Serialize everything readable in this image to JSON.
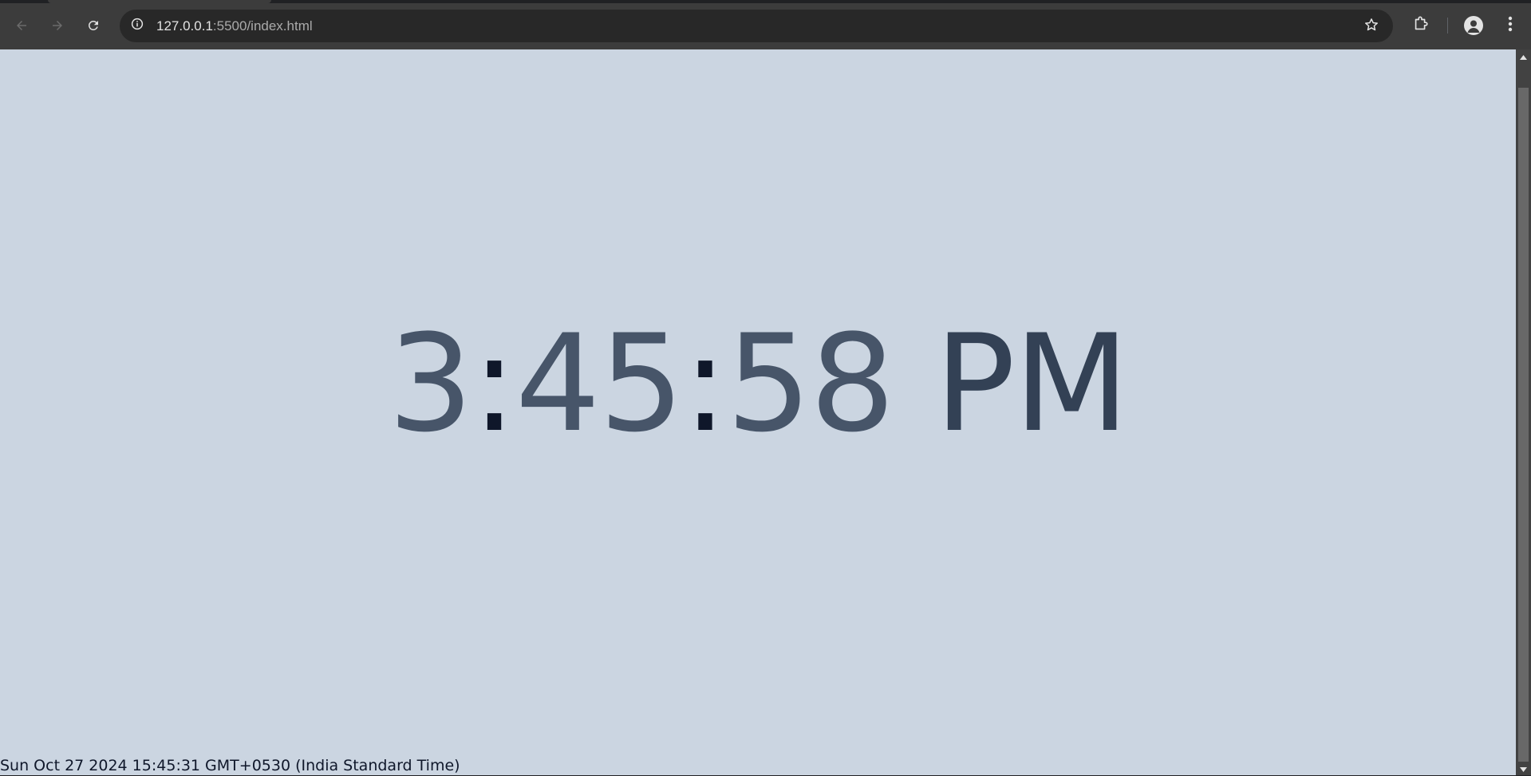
{
  "browser": {
    "url_host": "127.0.0.1",
    "url_path": ":5500/index.html",
    "icons": {
      "back": "arrow-left-icon",
      "forward": "arrow-right-icon",
      "reload": "reload-icon",
      "site_info": "info-icon",
      "bookmark": "star-icon",
      "extensions": "puzzle-icon",
      "profile": "person-icon",
      "menu": "kebab-menu-icon"
    }
  },
  "page": {
    "background": "#cbd5e1",
    "clock": {
      "hour": "3",
      "sep1": ":",
      "minute": "45",
      "sep2": ":",
      "second": "58",
      "ampm": "PM"
    },
    "date_string": "Sun Oct 27 2024 15:45:31 GMT+0530 (India Standard Time)"
  }
}
